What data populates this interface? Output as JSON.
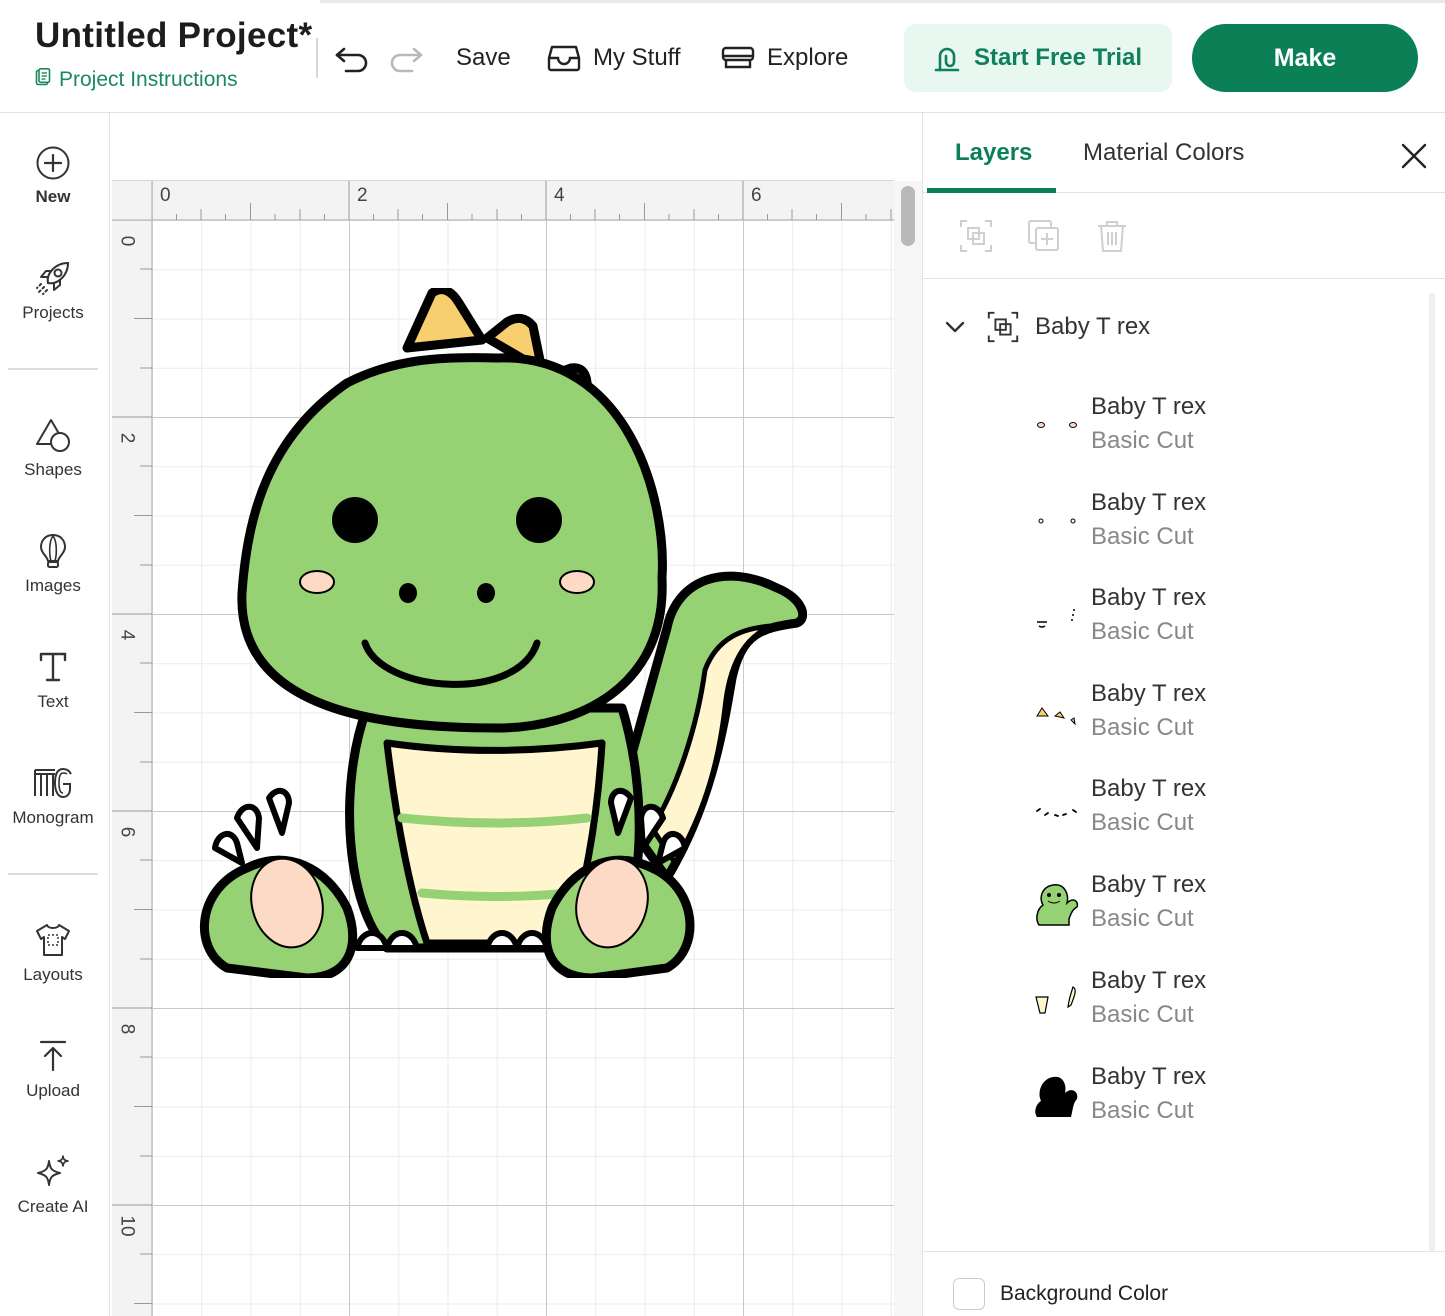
{
  "header": {
    "project_title": "Untitled Project*",
    "project_instructions": "Project Instructions",
    "save": "Save",
    "my_stuff": "My Stuff",
    "explore": "Explore",
    "start_trial": "Start Free Trial",
    "make": "Make"
  },
  "sidebar": {
    "items": [
      {
        "label": "New",
        "icon": "plus-circle-icon"
      },
      {
        "label": "Projects",
        "icon": "rocket-icon"
      },
      {
        "label": "Shapes",
        "icon": "shapes-icon"
      },
      {
        "label": "Images",
        "icon": "lightbulb-icon"
      },
      {
        "label": "Text",
        "icon": "text-icon"
      },
      {
        "label": "Monogram",
        "icon": "monogram-icon"
      },
      {
        "label": "Layouts",
        "icon": "tshirt-icon"
      },
      {
        "label": "Upload",
        "icon": "upload-icon"
      },
      {
        "label": "Create AI",
        "icon": "sparkle-icon"
      }
    ]
  },
  "canvas": {
    "ruler_top": [
      "0",
      "2",
      "4",
      "6"
    ],
    "ruler_left": [
      "0",
      "2",
      "4",
      "6",
      "8",
      "10"
    ]
  },
  "panel": {
    "tabs": {
      "layers": "Layers",
      "material_colors": "Material Colors"
    },
    "group_name": "Baby T rex",
    "layers": [
      {
        "name": "Baby T rex",
        "type": "Basic Cut"
      },
      {
        "name": "Baby T rex",
        "type": "Basic Cut"
      },
      {
        "name": "Baby T rex",
        "type": "Basic Cut"
      },
      {
        "name": "Baby T rex",
        "type": "Basic Cut"
      },
      {
        "name": "Baby T rex",
        "type": "Basic Cut"
      },
      {
        "name": "Baby T rex",
        "type": "Basic Cut"
      },
      {
        "name": "Baby T rex",
        "type": "Basic Cut"
      },
      {
        "name": "Baby T rex",
        "type": "Basic Cut"
      }
    ],
    "background_color": "Background Color"
  },
  "colors": {
    "brand_green": "#0b7f56",
    "dino_green": "#96d173",
    "belly_cream": "#fff6d0",
    "spike_yellow": "#f8cf6e",
    "cheek_pink": "#fddac6"
  }
}
